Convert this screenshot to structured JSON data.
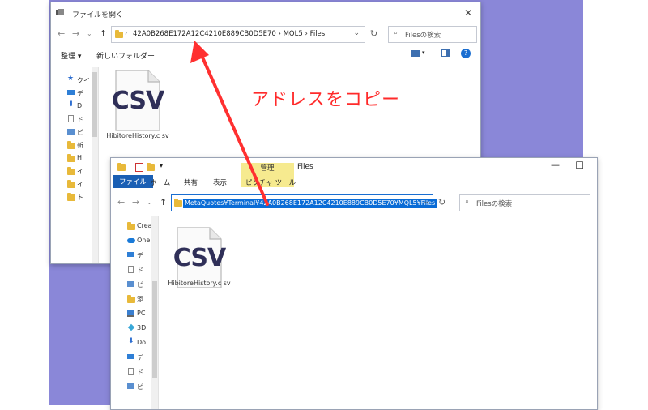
{
  "callout": "アドレスをコピー",
  "window_back": {
    "title": "ファイルを開く",
    "address_path": "42A0B268E172A12C4210E889CB0D5E70  ›  MQL5  ›  Files",
    "search_placeholder": "Filesの検索",
    "toolbar": {
      "organize": "整理 ▾",
      "new_folder": "新しいフォルダー"
    },
    "sidebar": [
      {
        "label": "クイ",
        "icon": "star-icon"
      },
      {
        "label": "デ",
        "icon": "desktop-icon"
      },
      {
        "label": "D",
        "icon": "download-icon"
      },
      {
        "label": "ド",
        "icon": "document-icon"
      },
      {
        "label": "ピ",
        "icon": "picture-icon"
      },
      {
        "label": "新",
        "icon": "folder-icon"
      },
      {
        "label": "H",
        "icon": "folder-icon"
      },
      {
        "label": "イ",
        "icon": "folder-icon"
      },
      {
        "label": "イ",
        "icon": "folder-icon"
      },
      {
        "label": "ト",
        "icon": "folder-icon"
      }
    ],
    "file": {
      "type": "CSV",
      "name": "HibitoreHistory.c sv"
    }
  },
  "window_front": {
    "title": "Files",
    "manage_tab": "管理",
    "picture_tools": "ピクチャ ツール",
    "tabs": [
      "ファイル",
      "ホーム",
      "共有",
      "表示"
    ],
    "address_path": "MetaQuotes¥Terminal¥42A0B268E172A12C4210E889CB0D5E70¥MQL5¥Files",
    "search_placeholder": "Filesの検索",
    "sidebar": [
      {
        "label": "Crea",
        "icon": "folder-icon"
      },
      {
        "label": "One",
        "icon": "cloud-icon"
      },
      {
        "label": "デ",
        "icon": "desktop-icon"
      },
      {
        "label": "ド",
        "icon": "document-icon"
      },
      {
        "label": "ピ",
        "icon": "picture-icon"
      },
      {
        "label": "添",
        "icon": "folder-icon"
      },
      {
        "label": "PC",
        "icon": "pc-icon"
      },
      {
        "label": "3D",
        "icon": "cube-icon"
      },
      {
        "label": "Do",
        "icon": "download-icon"
      },
      {
        "label": "デ",
        "icon": "desktop-icon"
      },
      {
        "label": "ド",
        "icon": "document-icon"
      },
      {
        "label": "ピ",
        "icon": "picture-icon"
      }
    ],
    "file": {
      "type": "CSV",
      "name": "HibitoreHistory.c sv"
    }
  },
  "colors": {
    "background": "#8a87d8",
    "accent": "#1a5fb4",
    "callout": "#ff2a2a",
    "manage": "#f6ea8f"
  }
}
